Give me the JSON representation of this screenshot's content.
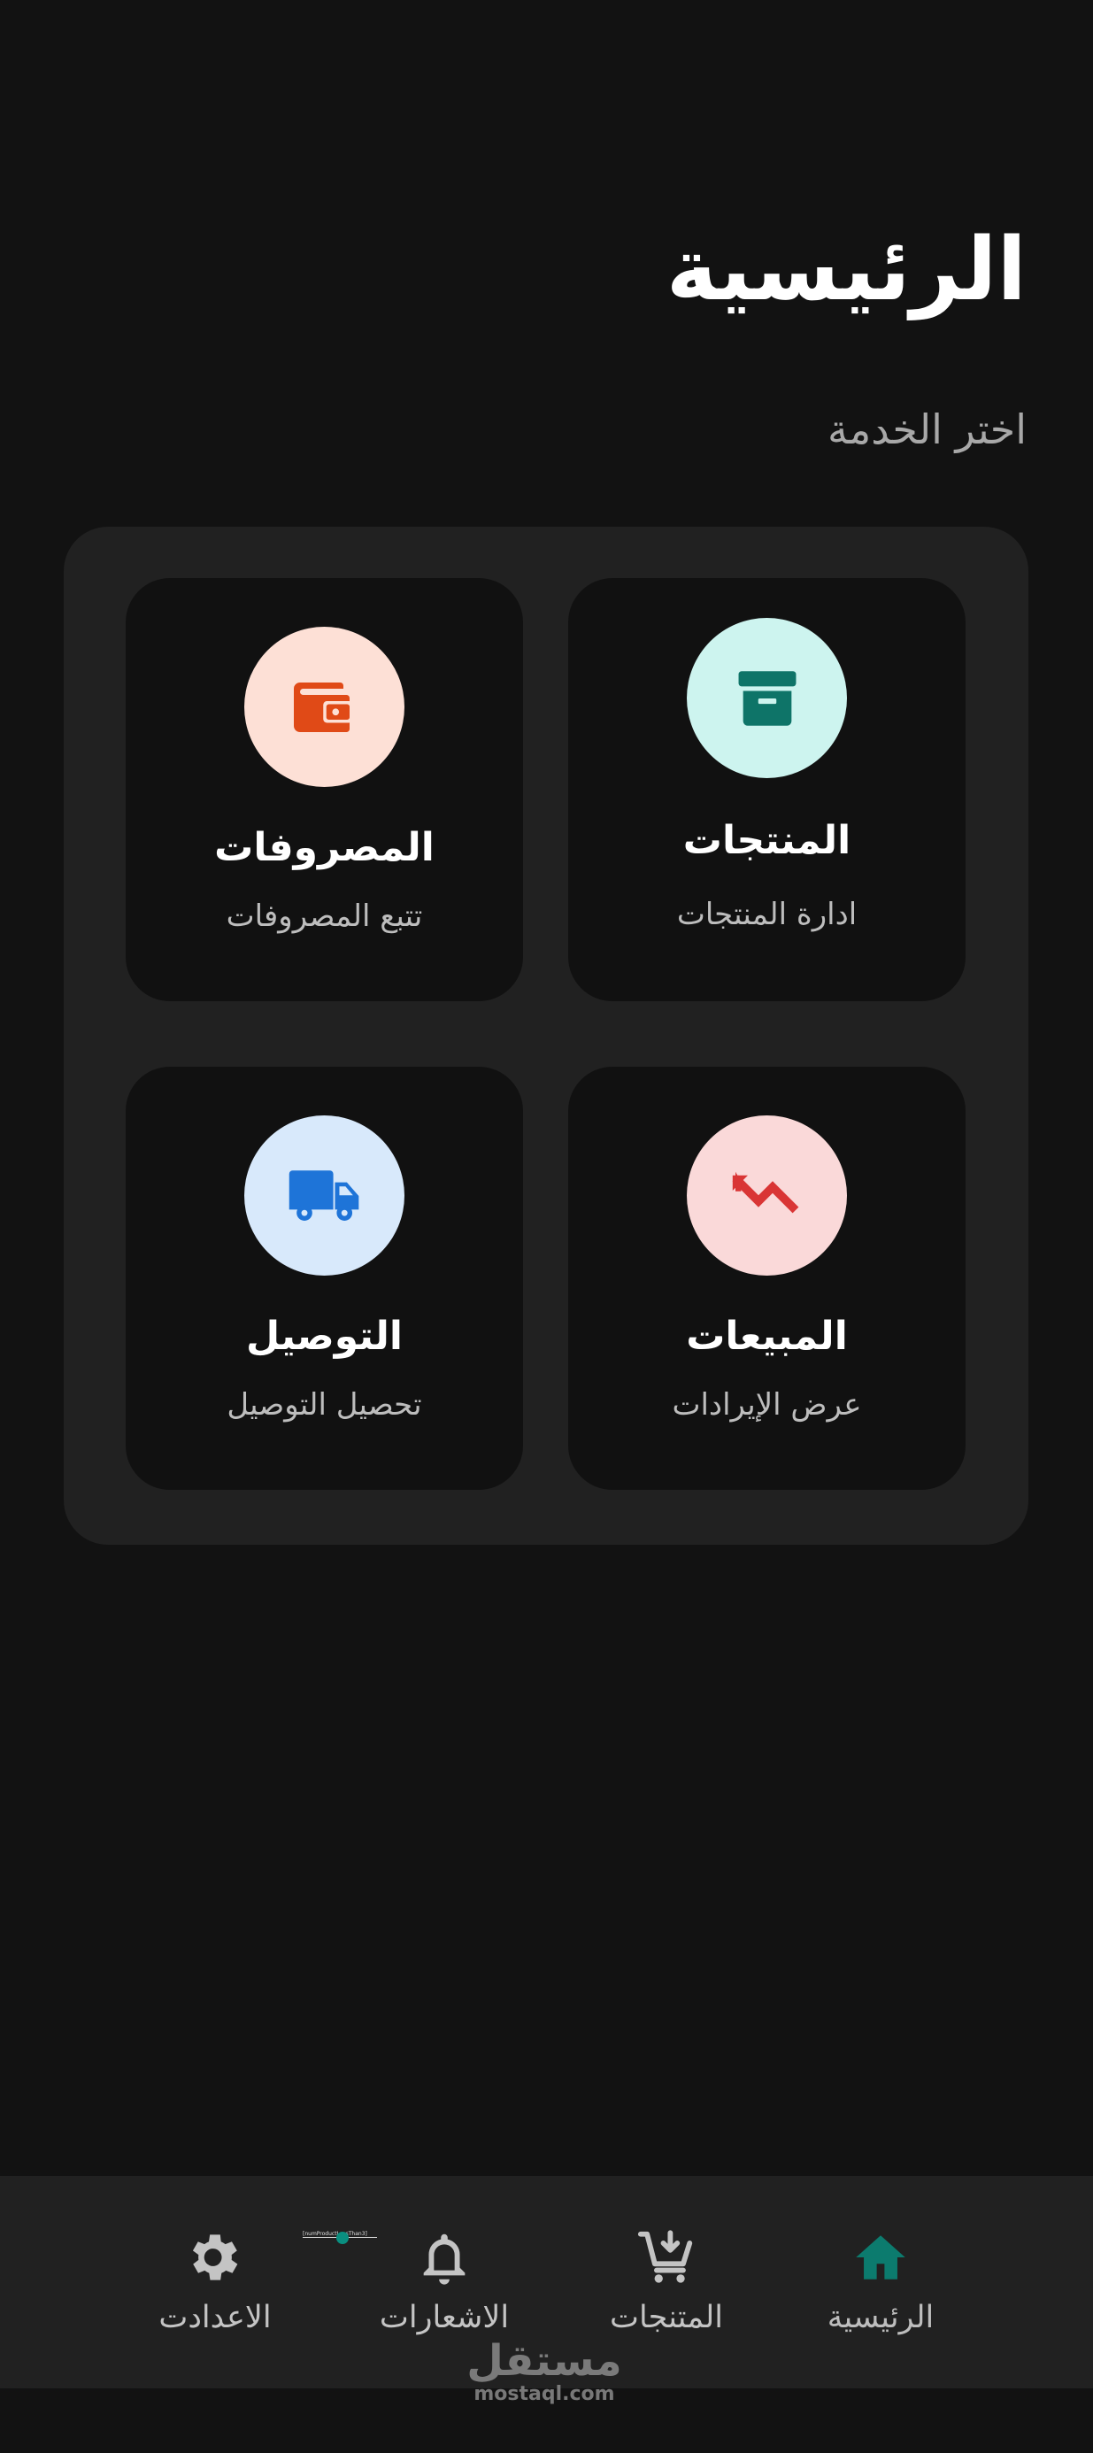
{
  "header": {
    "title": "الرئيسية",
    "subtitle": "اختر الخدمة"
  },
  "services": [
    {
      "id": "products",
      "title": "المنتجات",
      "description": "ادارة المنتجات",
      "icon": "archive-box-icon",
      "icon_color": "#0e7468",
      "icon_bg": "#cdf4ef"
    },
    {
      "id": "expenses",
      "title": "المصروفات",
      "description": "تتبع المصروفات",
      "icon": "wallet-icon",
      "icon_color": "#e04a17",
      "icon_bg": "#fde0d6"
    },
    {
      "id": "sales",
      "title": "المبيعات",
      "description": "عرض الإيرادات",
      "icon": "trending-down-icon",
      "icon_color": "#d93535",
      "icon_bg": "#fad9d9"
    },
    {
      "id": "delivery",
      "title": "التوصيل",
      "description": "تحصيل التوصيل",
      "icon": "truck-icon",
      "icon_color": "#1e74d8",
      "icon_bg": "#d8e9fb"
    }
  ],
  "bottom_nav": {
    "active": "home",
    "active_color": "#0c7b6e",
    "items": [
      {
        "id": "home",
        "label": "الرئيسية",
        "icon": "home-icon"
      },
      {
        "id": "products",
        "label": "المتنجات",
        "icon": "cart-icon"
      },
      {
        "id": "notifications",
        "label": "الاشعارات",
        "icon": "bell-icon"
      },
      {
        "id": "settings",
        "label": "الاعدادت",
        "icon": "gear-icon"
      }
    ]
  },
  "debug_tag": {
    "text": "[numProductLessThan3]"
  },
  "watermark": {
    "arabic": "مستقل",
    "latin": "mostaql.com"
  },
  "colors": {
    "background": "#121212",
    "panel": "#212121",
    "card": "#111111",
    "nav_bar": "#212121"
  }
}
